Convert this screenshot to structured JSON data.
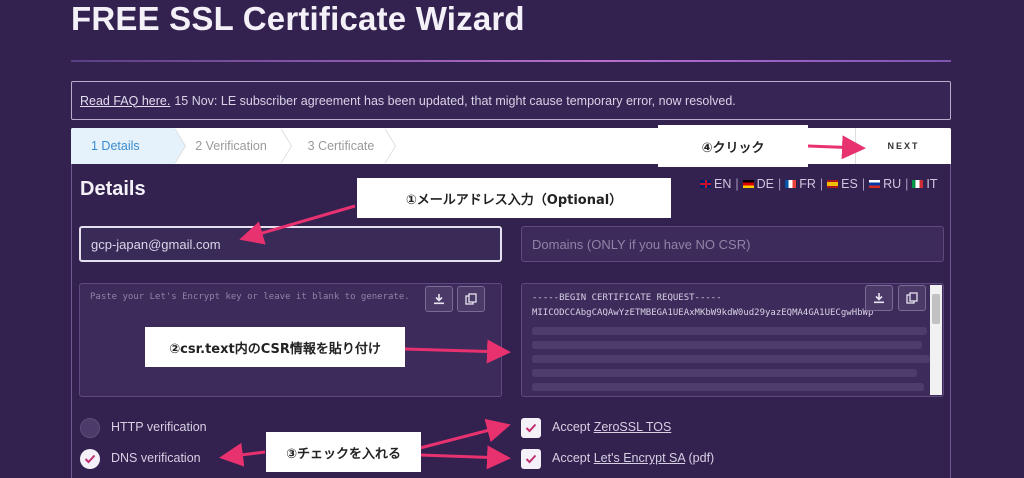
{
  "header": {
    "title": "FREE SSL Certificate Wizard"
  },
  "notice": {
    "faq_link": "Read FAQ here.",
    "text": "15 Nov: LE subscriber agreement has been updated, that might cause temporary error, now resolved."
  },
  "steps": [
    {
      "label": "1  Details"
    },
    {
      "label": "2  Verification"
    },
    {
      "label": "3  Certificate"
    }
  ],
  "next_label": "NEXT",
  "details_heading": "Details",
  "languages": [
    {
      "code": "EN"
    },
    {
      "code": "DE"
    },
    {
      "code": "FR"
    },
    {
      "code": "ES"
    },
    {
      "code": "RU"
    },
    {
      "code": "IT"
    }
  ],
  "form": {
    "email_value": "gcp-japan@gmail.com",
    "domains_placeholder": "Domains (ONLY if you have NO CSR)",
    "key_placeholder": "Paste your Let's Encrypt key or leave it blank to generate.",
    "csr_header": "-----BEGIN CERTIFICATE REQUEST-----",
    "csr_first_line": "MIICODCCAbgCAQAwYzETMBEGA1UEAxMKbW9kdW0ud29yazEQMA4GA1UECgwHbWp"
  },
  "options": {
    "http_label": "HTTP verification",
    "dns_label": "DNS verification",
    "accept_prefix": "Accept",
    "zerossl_link": "ZeroSSL TOS",
    "le_link": "Let's Encrypt SA",
    "le_suffix": "(pdf)"
  },
  "callouts": {
    "email": "①メールアドレス入力（Optional）",
    "csr": "②csr.text内のCSR情報を貼り付け",
    "check": "③チェックを入れる",
    "click": "④クリック"
  },
  "colors": {
    "background": "#33214f",
    "arrow": "#e8316f",
    "active_step": "#3a8bd1"
  }
}
